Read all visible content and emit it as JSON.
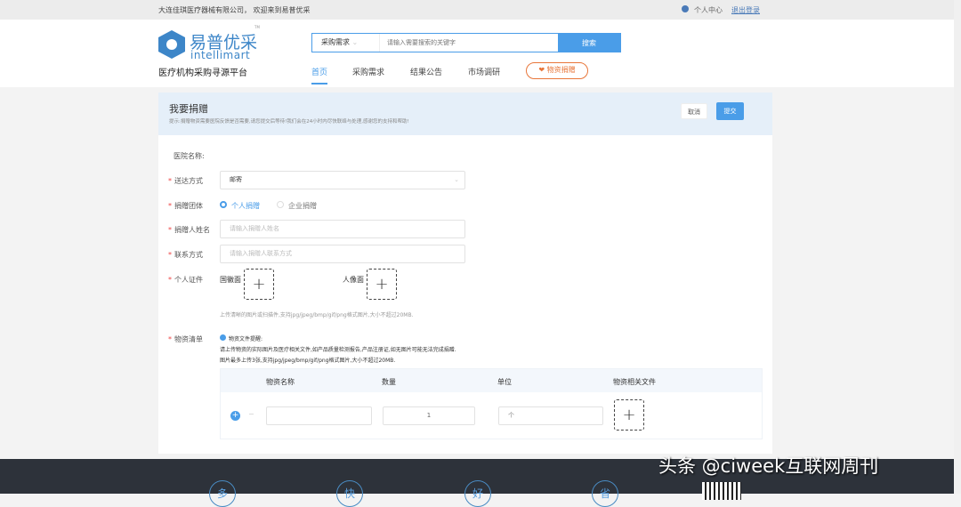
{
  "topbar": {
    "welcome": "大连佳琪医疗器械有限公司， 欢迎来到易普优采",
    "user_center": "个人中心",
    "logout": "退出登录"
  },
  "logo": {
    "name": "易普优采",
    "sub": "intellimart",
    "tagline": "医疗机构采购寻源平台",
    "tm": "TM"
  },
  "search": {
    "category": "采购需求",
    "placeholder": "请输入需要搜索的关键字",
    "button": "搜索"
  },
  "nav": {
    "items": [
      "首页",
      "采购需求",
      "结果公告",
      "市场调研"
    ],
    "donate": "物资捐赠"
  },
  "banner": {
    "title": "我要捐赠",
    "desc": "提示:捐赠物资需要医院反馈是否需要,请您提交后等待!我们会在24小时内尽快联络与处理,感谢您的支持和帮助!",
    "cancel": "取消",
    "submit": "提交"
  },
  "form": {
    "hospital_label": "医院名称:",
    "delivery_label": "送达方式",
    "delivery_value": "邮寄",
    "group_label": "捐赠团体",
    "group_options": [
      "个人捐赠",
      "企业捐赠"
    ],
    "name_label": "捐赠人姓名",
    "name_placeholder": "请输入捐赠人姓名",
    "contact_label": "联系方式",
    "contact_placeholder": "请输入捐赠人联系方式",
    "id_label": "个人证件",
    "id_front": "国徽面",
    "id_back": "人像面",
    "id_hint": "上传清晰的图片或扫描件,支持jpg/jpeg/bmp/gif/png格式图片,大小不超过20MB.",
    "list_label": "物资清单",
    "tip_title": "物资文件提醒:",
    "tip_line1": "请上传物资的实际图片及医疗相关文件,如产品质量检测报告,产品注册证,如无图片可能无法完成捐赠.",
    "tip_line2": "图片最多上传3张,支持jpg/jpeg/bmp/gif/png格式图片,大小不超过20MB.",
    "table_headers": [
      "物资名称",
      "数量",
      "单位",
      "物资相关文件"
    ],
    "row": {
      "name": "",
      "qty": "1",
      "unit": "个"
    }
  },
  "footer": {
    "circles": [
      "多",
      "快",
      "好",
      "省"
    ]
  },
  "watermark": "头条 @ciweek互联网周刊"
}
